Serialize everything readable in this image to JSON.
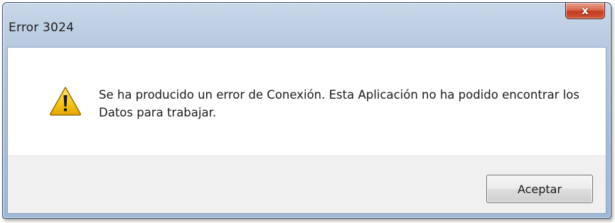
{
  "window": {
    "title": "Error 3024",
    "close_label": "x"
  },
  "dialog": {
    "icon": "warning-icon",
    "message": "Se ha producido un error de Conexión. Esta Aplicación no ha podido encontrar los Datos para trabajar.",
    "ok_label": "Aceptar"
  },
  "colors": {
    "title_frame": "#b7c9df",
    "close_button": "#c23b1f",
    "warning_fill": "#f5c51a",
    "footer_bg": "#f0f0f0"
  }
}
